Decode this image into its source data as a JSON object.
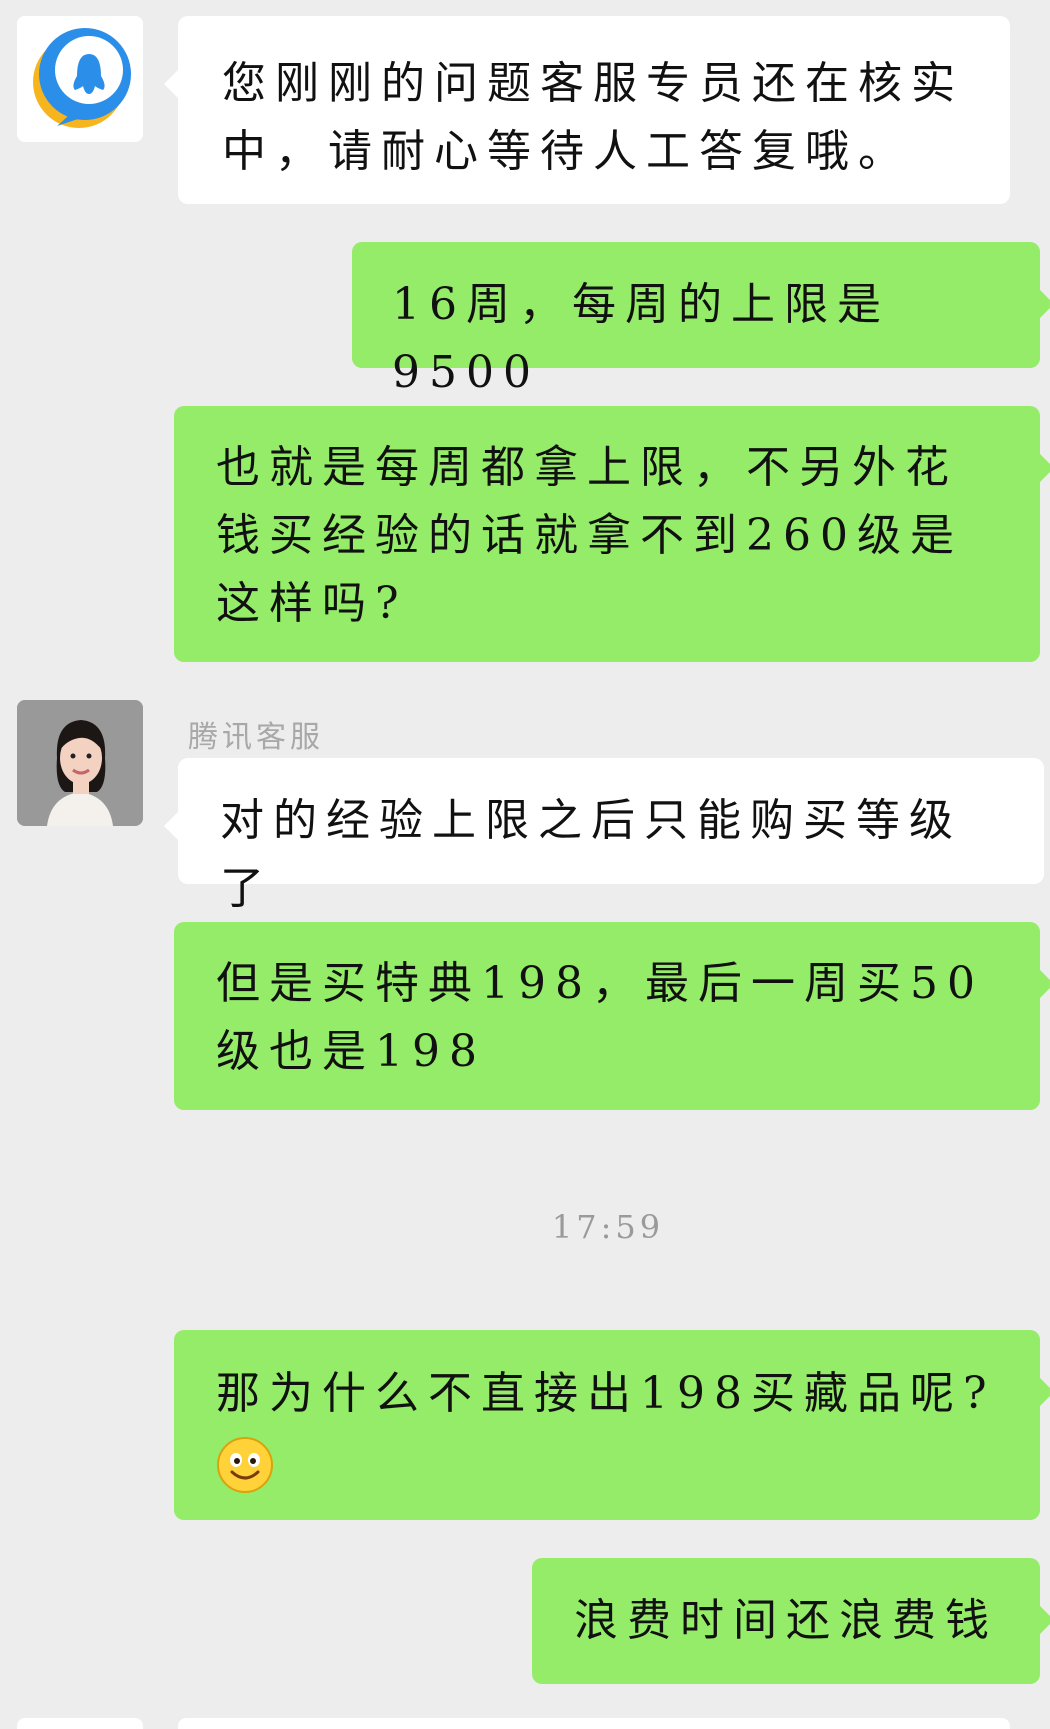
{
  "messages": [
    {
      "id": "m1",
      "sender": "bot",
      "text": "您刚刚的问题客服专员还在核实中，请耐心等待人工答复哦。"
    },
    {
      "id": "m2",
      "sender": "me",
      "text": "16周，每周的上限是9500"
    },
    {
      "id": "m3",
      "sender": "me",
      "text": "也就是每周都拿上限，不另外花钱买经验的话就拿不到260级是这样吗?"
    },
    {
      "id": "m4",
      "sender": "agent",
      "sender_name": "腾讯客服",
      "text": "对的经验上限之后只能购买等级了"
    },
    {
      "id": "m5",
      "sender": "me",
      "text": "但是买特典198，最后一周买50级也是198"
    },
    {
      "id": "m6",
      "sender": "me",
      "text": "那为什么不直接出198买藏品呢?",
      "emoji": "smile-emoji"
    },
    {
      "id": "m7",
      "sender": "me",
      "text": "浪费时间还浪费钱"
    }
  ],
  "timestamp": "17:59",
  "colors": {
    "background": "#ededed",
    "incoming_bubble": "#ffffff",
    "outgoing_bubble": "#95ec69",
    "sender_name": "#a8a8a8",
    "timestamp": "#9a9a9a",
    "bot_avatar_blue": "#2b8ee8",
    "bot_avatar_yellow": "#f6b51e"
  },
  "icons": {
    "bot_avatar": "qq-service-bot-icon",
    "agent_avatar": "agent-avatar-photo"
  }
}
